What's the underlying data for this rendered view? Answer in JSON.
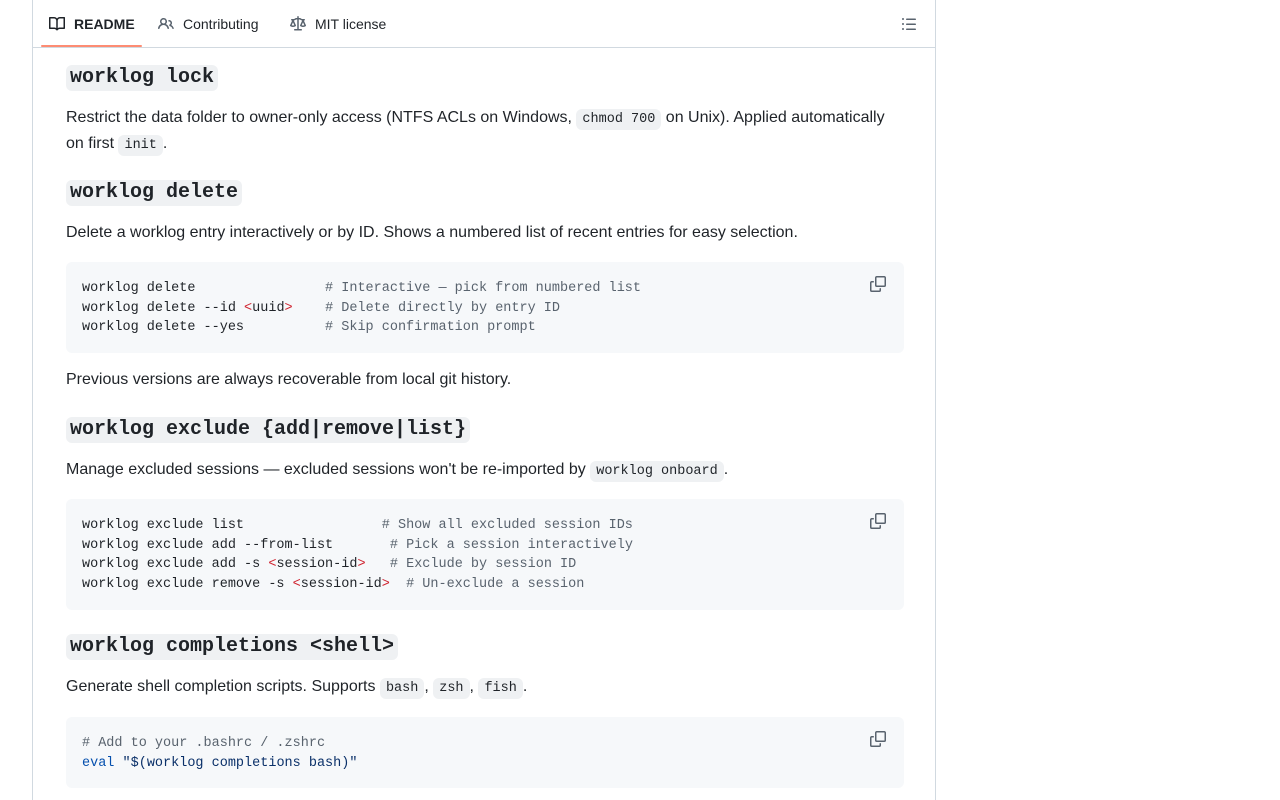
{
  "tabs": [
    {
      "label": "README",
      "icon": "book-icon",
      "active": true
    },
    {
      "label": "Contributing",
      "icon": "people-icon",
      "active": false
    },
    {
      "label": "MIT license",
      "icon": "law-icon",
      "active": false
    }
  ],
  "sections": {
    "lock": {
      "heading": "worklog lock",
      "text_1": "Restrict the data folder to owner-only access (NTFS ACLs on Windows, ",
      "code_1": "chmod 700",
      "text_2": " on Unix). Applied automatically on first ",
      "code_2": "init",
      "text_3": "."
    },
    "delete": {
      "heading": "worklog delete",
      "description": "Delete a worklog entry interactively or by ID. Shows a numbered list of recent entries for easy selection.",
      "code": {
        "l1_cmd": "worklog delete",
        "l1_pad": "                ",
        "l1_comment": "# Interactive — pick from numbered list",
        "l2_cmd": "worklog delete --id ",
        "l2_lt": "<",
        "l2_arg": "uuid",
        "l2_gt": ">",
        "l2_pad": "    ",
        "l2_comment": "# Delete directly by entry ID",
        "l3_cmd": "worklog delete --yes",
        "l3_pad": "          ",
        "l3_comment": "# Skip confirmation prompt"
      },
      "note": "Previous versions are always recoverable from local git history."
    },
    "exclude": {
      "heading": "worklog exclude {add|remove|list}",
      "text_1": "Manage excluded sessions — excluded sessions won't be re-imported by ",
      "code_1": "worklog onboard",
      "text_2": ".",
      "code": {
        "l1_cmd": "worklog exclude list",
        "l1_pad": "                 ",
        "l1_comment": "# Show all excluded session IDs",
        "l2_cmd": "worklog exclude add --from-list",
        "l2_pad": "       ",
        "l2_comment": "# Pick a session interactively",
        "l3_cmd": "worklog exclude add -s ",
        "l3_lt": "<",
        "l3_arg": "session-id",
        "l3_gt": ">",
        "l3_pad": "   ",
        "l3_comment": "# Exclude by session ID",
        "l4_cmd": "worklog exclude remove -s ",
        "l4_lt": "<",
        "l4_arg": "session-id",
        "l4_gt": ">",
        "l4_pad": "  ",
        "l4_comment": "# Un-exclude a session"
      }
    },
    "completions": {
      "heading": "worklog completions <shell>",
      "text_1": "Generate shell completion scripts. Supports ",
      "code_1": "bash",
      "sep_1": ", ",
      "code_2": "zsh",
      "sep_2": ", ",
      "code_3": "fish",
      "text_2": ".",
      "code": {
        "l1_comment": "# Add to your .bashrc / .zshrc",
        "l2_kw": "eval",
        "l2_sp": " ",
        "l2_str": "\"$(worklog completions bash)\""
      }
    }
  }
}
